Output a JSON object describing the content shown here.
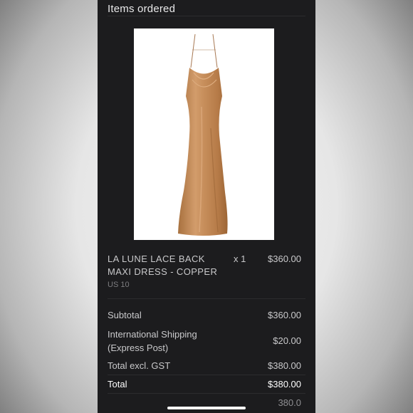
{
  "header": {
    "title": "Items ordered"
  },
  "item": {
    "name": "LA LUNE LACE BACK MAXI DRESS - COPPER",
    "quantity": "x 1",
    "price": "$360.00",
    "size": "US 10",
    "image_icon": "copper-satin-maxi-dress"
  },
  "summary": {
    "subtotal_label": "Subtotal",
    "subtotal_value": "$360.00",
    "shipping_label_line1": "International Shipping",
    "shipping_label_line2": "(Express Post)",
    "shipping_value": "$20.00",
    "total_excl_label": "Total excl. GST",
    "total_excl_value": "$380.00",
    "total_label": "Total",
    "total_value": "$380.00",
    "extra_value": "380.0"
  },
  "colors": {
    "panel": "#1c1c1e",
    "text": "#c9c9cb",
    "dress": "#c08a5a"
  }
}
